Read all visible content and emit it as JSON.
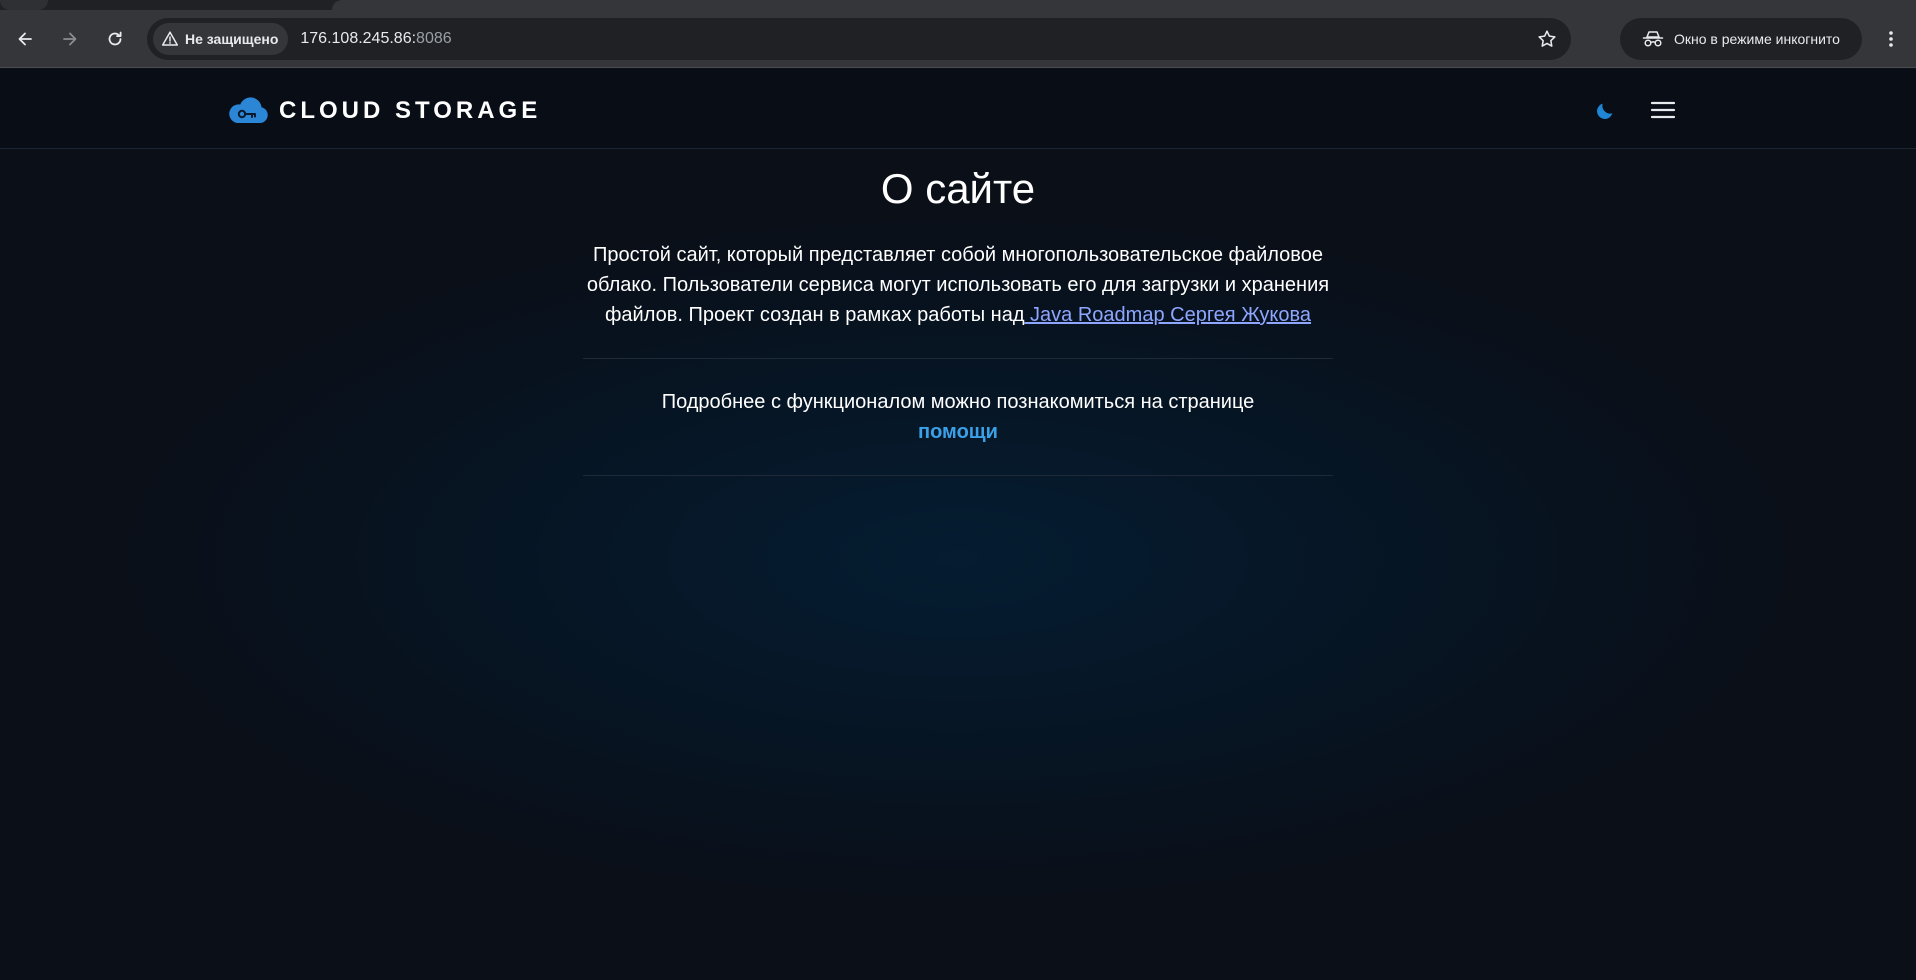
{
  "browser": {
    "security_label": "Не защищено",
    "url_host": "176.108.245.86:",
    "url_port": "8086",
    "incognito_label": "Окно в режиме инкогнито"
  },
  "site": {
    "brand": "CLOUD STORAGE",
    "accent": "#2b86d6"
  },
  "about": {
    "title": "О сайте",
    "intro_text": "Простой сайт, который представляет собой многопользовательское файловое облако. Пользователи сервиса могут использовать его для загрузки и хранения файлов. Проект создан в рамках работы над",
    "intro_link": " Java Roadmap Сергея Жукова",
    "more_text": "Подробнее с функционалом можно познакомиться на странице",
    "more_link": "помощи"
  }
}
